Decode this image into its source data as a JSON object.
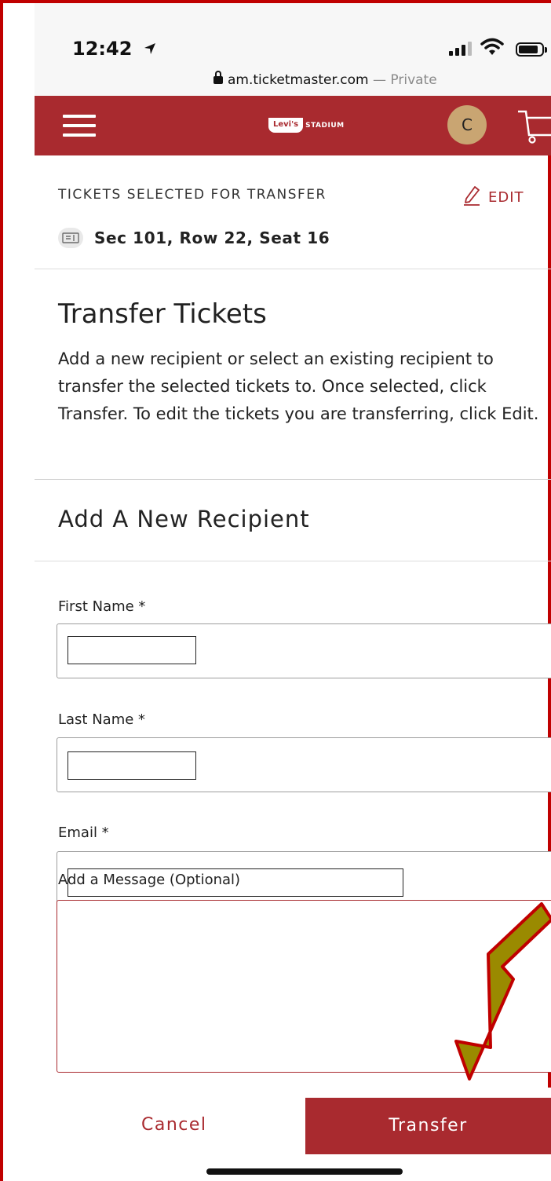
{
  "status": {
    "time": "12:42",
    "url": "am.ticketmaster.com",
    "url_sep": " — ",
    "private_label": "Private"
  },
  "header": {
    "logo_levis": "Levi's",
    "logo_stadium": "STADIUM",
    "avatar_initial": "C"
  },
  "selection": {
    "label": "TICKETS SELECTED FOR TRANSFER",
    "edit_label": "EDIT",
    "seat": "Sec 101, Row 22, Seat 16"
  },
  "transfer": {
    "title": "Transfer Tickets",
    "description": "Add a new recipient or select an existing recipient to transfer the selected tickets to. Once selected, click Transfer. To edit the tickets you are transferring, click Edit."
  },
  "recipient": {
    "section_title": "Add A New Recipient",
    "first_name_label": "First Name *",
    "first_name_value": "",
    "last_name_label": "Last Name *",
    "last_name_value": "",
    "email_label": "Email *",
    "email_value": "",
    "message_label": "Add a Message (Optional)",
    "message_value": ""
  },
  "footer": {
    "cancel_label": "Cancel",
    "transfer_label": "Transfer"
  },
  "colors": {
    "brand": "#a92a2f",
    "annotation_arrow": "#9a8a00",
    "frame": "#c00000"
  }
}
